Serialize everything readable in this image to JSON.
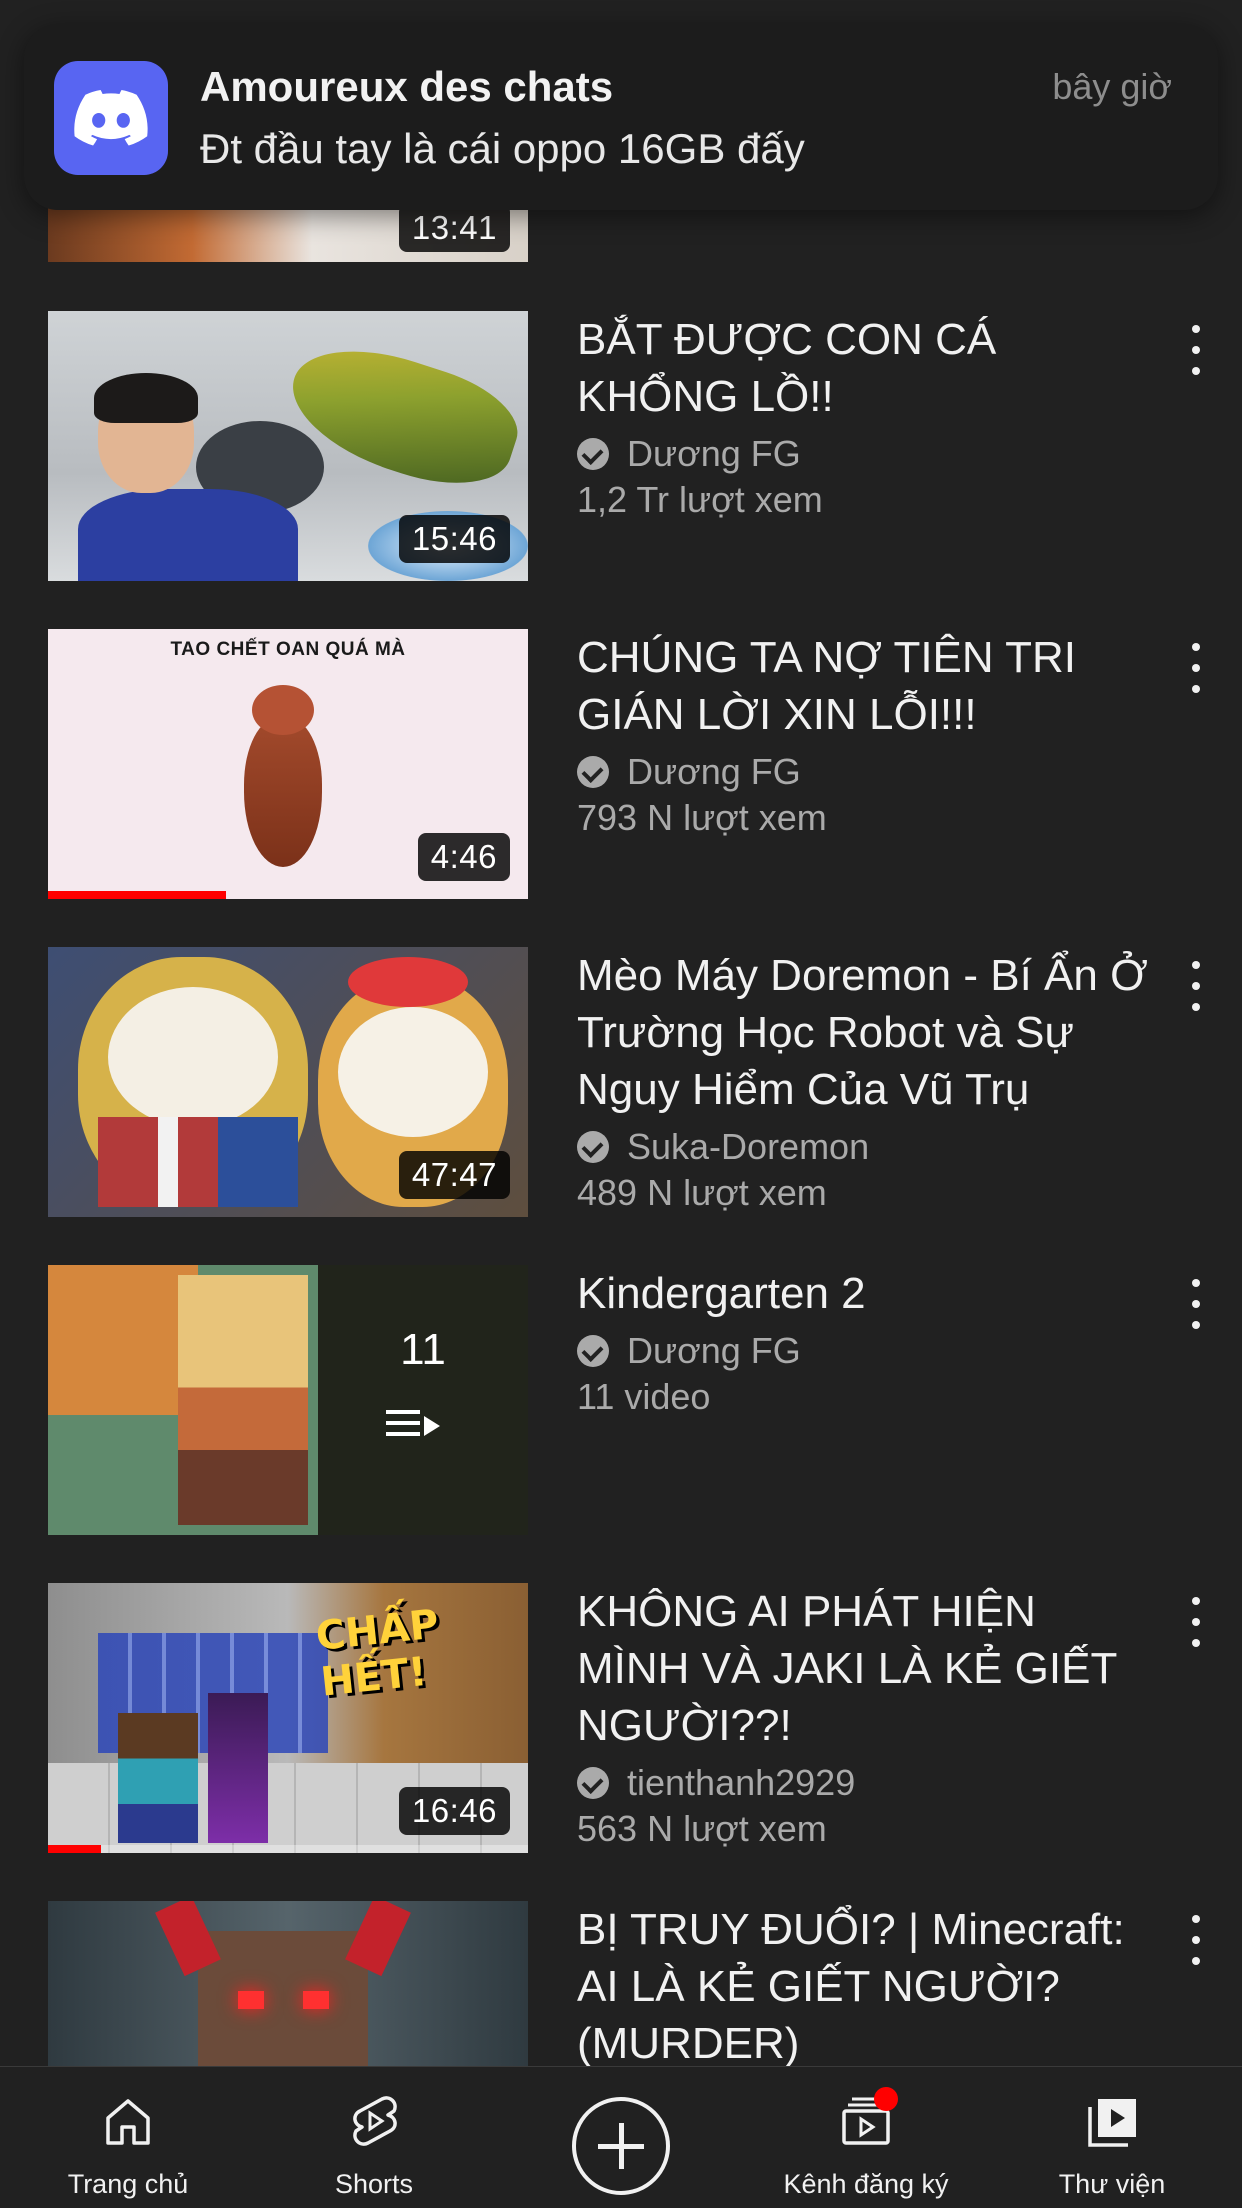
{
  "notification": {
    "app": "Discord",
    "title": "Amoureux des chats",
    "message": "Đt đầu tay là cái oppo 16GB đấy",
    "time": "bây giờ",
    "icon": "discord-icon",
    "accent": "#5865f2"
  },
  "partial_video": {
    "duration": "13:41"
  },
  "videos": [
    {
      "title": "BẮT ĐƯỢC CON CÁ KHỔNG LỒ!!",
      "channel": "Dương FG",
      "meta": "1,2 Tr lượt xem",
      "duration": "15:46",
      "progress": 0
    },
    {
      "title": "CHÚNG TA NỢ TIÊN TRI GIÁN LỜI XIN LỖI!!!",
      "channel": "Dương FG",
      "meta": "793 N lượt xem",
      "duration": "4:46",
      "thumb_caption": "TAO CHẾT OAN QUÁ MÀ",
      "progress": 0.37
    },
    {
      "title": "Mèo Máy Doremon - Bí Ẩn Ở Trường Học Robot và Sự Nguy Hiểm Của Vũ Trụ",
      "channel": "Suka-Doremon",
      "meta": "489 N lượt xem",
      "duration": "47:47",
      "progress": 0
    },
    {
      "title": "Kindergarten 2",
      "channel": "Dương FG",
      "meta": "11 video",
      "playlist_count": "11",
      "is_playlist": true
    },
    {
      "title": "KHÔNG AI PHÁT HIỆN MÌNH VÀ JAKI LÀ KẺ GIẾT NGƯỜI??!",
      "channel": "tienthanh2929",
      "meta": "563 N lượt xem",
      "duration": "16:46",
      "thumb_caption": "CHẤP HẾT!",
      "progress": 0.11
    },
    {
      "title": "BỊ TRUY ĐUỔI? | Minecraft: AI LÀ KẺ GIẾT NGƯỜI? (MURDER)",
      "channel": "",
      "meta": ""
    }
  ],
  "nav": {
    "home": "Trang chủ",
    "shorts": "Shorts",
    "subscriptions": "Kênh đăng ký",
    "library": "Thư viện"
  },
  "colors": {
    "background": "#212121",
    "progress": "#ff0000",
    "secondary_text": "#aaaaaa"
  }
}
